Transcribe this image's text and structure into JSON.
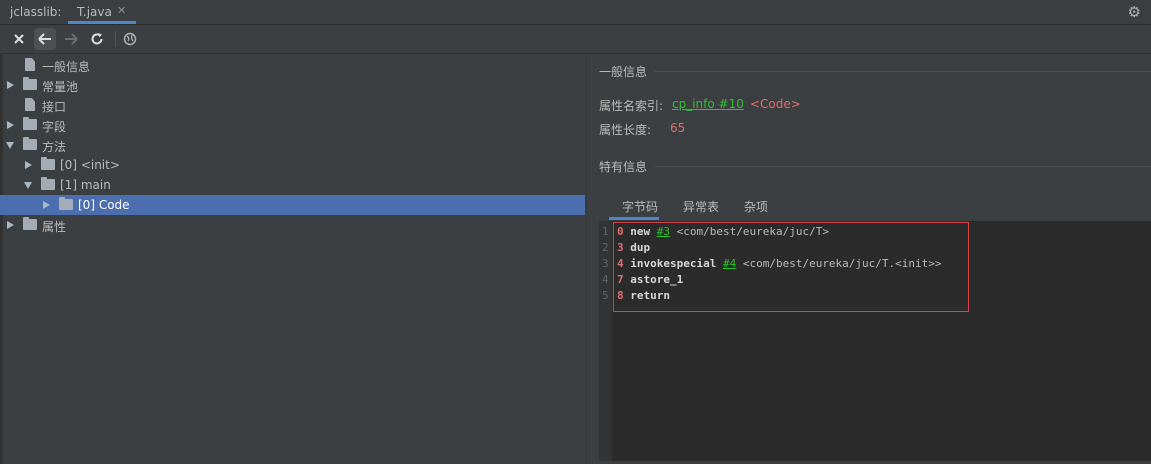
{
  "tabbar": {
    "tool_label": "jclasslib:",
    "active_tab": "T.java",
    "close_glyph": "✕",
    "settings_icon": "gear-icon"
  },
  "toolbar": {
    "buttons": [
      "close-icon",
      "back-arrow-icon",
      "forward-arrow-icon",
      "refresh-icon",
      "web-icon"
    ]
  },
  "tree": {
    "nodes": [
      {
        "label": "一般信息",
        "icon": "file"
      },
      {
        "label": "常量池",
        "icon": "folder"
      },
      {
        "label": "接口",
        "icon": "file"
      },
      {
        "label": "字段",
        "icon": "folder"
      },
      {
        "label": "方法",
        "icon": "folder"
      },
      {
        "label": "[0] <init>",
        "icon": "folder"
      },
      {
        "label": "[1] main",
        "icon": "folder"
      },
      {
        "label": "[0] Code",
        "icon": "folder",
        "selected": true
      },
      {
        "label": "属性",
        "icon": "folder"
      }
    ]
  },
  "general": {
    "title": "一般信息",
    "attr_name_index_label": "属性名索引:",
    "attr_name_index_link": "cp_info #10",
    "attr_name_index_value": "<Code>",
    "attr_length_label": "属性长度:",
    "attr_length_value": "65"
  },
  "specific": {
    "title": "特有信息",
    "tabs": [
      "字节码",
      "异常表",
      "杂项"
    ]
  },
  "code": {
    "lines": [
      {
        "num": "1",
        "offset": "0",
        "op": "new",
        "ref": "#3",
        "arg": "<com/best/eureka/juc/T>"
      },
      {
        "num": "2",
        "offset": "3",
        "op": "dup",
        "ref": "",
        "arg": ""
      },
      {
        "num": "3",
        "offset": "4",
        "op": "invokespecial",
        "ref": "#4",
        "arg": "<com/best/eureka/juc/T.<init>>"
      },
      {
        "num": "4",
        "offset": "7",
        "op": "astore_1",
        "ref": "",
        "arg": ""
      },
      {
        "num": "5",
        "offset": "8",
        "op": "return",
        "ref": "",
        "arg": ""
      }
    ]
  },
  "colors": {
    "background": "#3c3f41",
    "selection": "#4b6eaf",
    "link": "#30c030",
    "value": "#e06c6c",
    "highlight_border": "#d64545",
    "accent": "#4a88c7"
  }
}
